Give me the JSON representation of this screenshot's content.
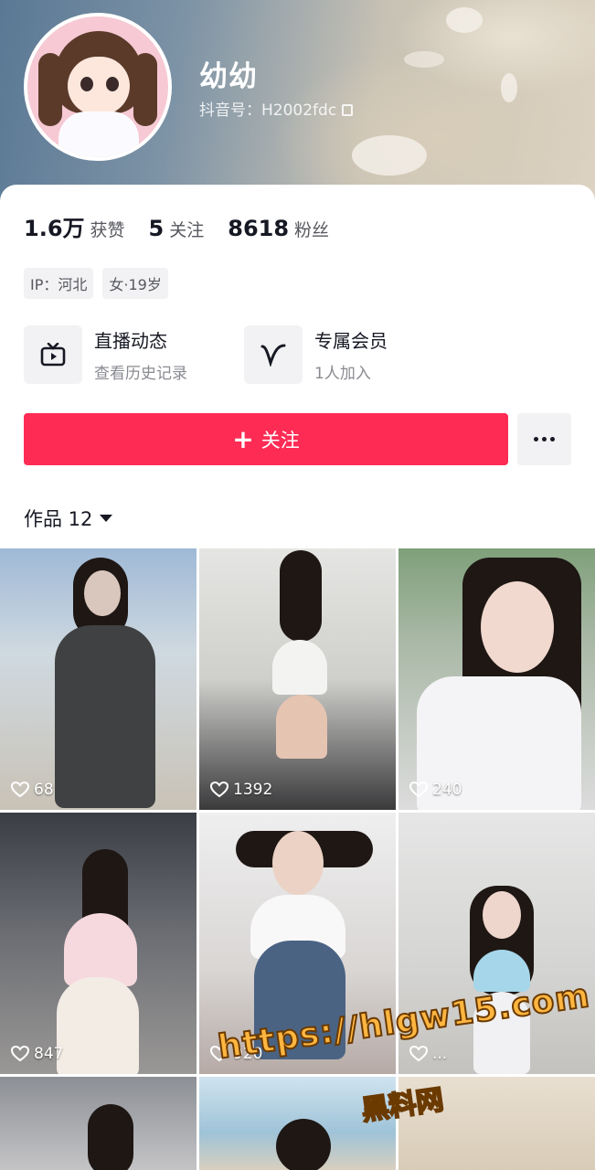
{
  "profile": {
    "nickname": "幼幼",
    "douyin_id": "抖音号：H2002fdc"
  },
  "stats": [
    {
      "value": "1.6万",
      "label": "获赞"
    },
    {
      "value": "5",
      "label": "关注"
    },
    {
      "value": "8618",
      "label": "粉丝"
    }
  ],
  "tags": [
    "IP：河北",
    "女·19岁"
  ],
  "features": [
    {
      "title": "直播动态",
      "subtitle": "查看历史记录",
      "icon": "tv-icon"
    },
    {
      "title": "专属会员",
      "subtitle": "1人加入",
      "icon": "v-icon"
    }
  ],
  "actions": {
    "follow_label": "关注",
    "more_icon": "ellipsis-icon"
  },
  "works_tab": {
    "label": "作品 12"
  },
  "videos": [
    {
      "likes": "68"
    },
    {
      "likes": "1392"
    },
    {
      "likes": "240"
    },
    {
      "likes": "847"
    },
    {
      "likes": "920"
    },
    {
      "likes": "..."
    }
  ],
  "watermark": {
    "url": "https://hlgw15.com",
    "brand": "黑料网"
  },
  "colors": {
    "primary": "#fe2c55",
    "text": "#161823",
    "secondary_text": "#57585f",
    "chip_bg": "#f2f2f4"
  }
}
